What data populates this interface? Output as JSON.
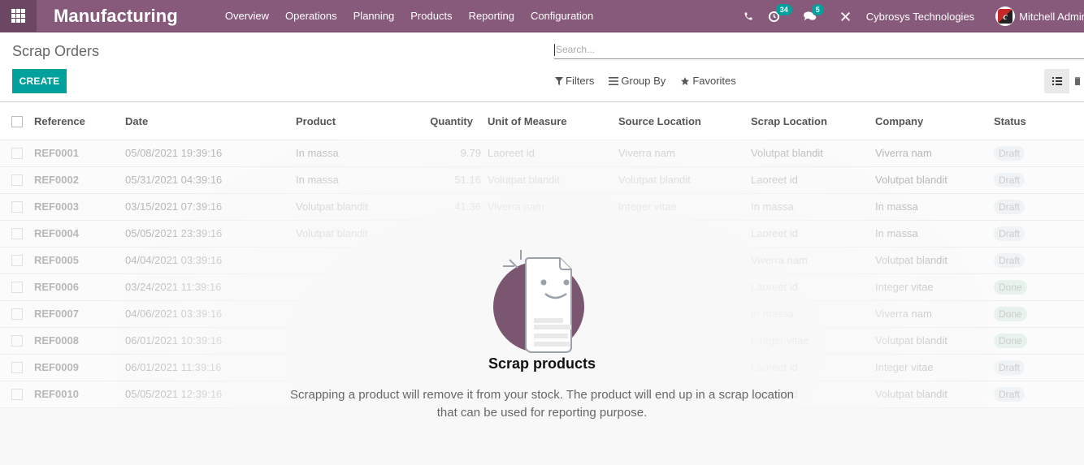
{
  "navbar": {
    "apps_icon": "grid-icon",
    "brand": "Manufacturing",
    "menu": [
      "Overview",
      "Operations",
      "Planning",
      "Products",
      "Reporting",
      "Configuration"
    ],
    "systray": {
      "phone_icon": "phone-icon",
      "activity_icon": "clock-icon",
      "activity_count": "34",
      "messages_icon": "chat-icon",
      "messages_count": "5",
      "debug_icon": "tools-icon",
      "company": "Cybrosys Technologies",
      "user": "Mitchell Admin"
    }
  },
  "control_panel": {
    "title": "Scrap Orders",
    "create_label": "CREATE",
    "search_placeholder": "Search...",
    "search_value": "",
    "filters_label": "Filters",
    "groupby_label": "Group By",
    "favorites_label": "Favorites",
    "views": [
      {
        "name": "list",
        "icon": "list-view-icon",
        "active": true
      },
      {
        "name": "kanban",
        "icon": "kanban-view-icon",
        "active": false
      }
    ]
  },
  "table": {
    "columns": [
      "Reference",
      "Date",
      "Product",
      "Quantity",
      "Unit of Measure",
      "Source Location",
      "Scrap Location",
      "Company",
      "Status"
    ],
    "rows": [
      {
        "ref": "REF0001",
        "date": "05/08/2021 19:39:16",
        "product": "In massa",
        "qty": "9.79",
        "uom": "Laoreet id",
        "source": "Viverra nam",
        "scrap": "Volutpat blandit",
        "company": "Viverra nam",
        "status": "Draft"
      },
      {
        "ref": "REF0002",
        "date": "05/31/2021 04:39:16",
        "product": "In massa",
        "qty": "51.16",
        "uom": "Volutpat blandit",
        "source": "Volutpat blandit",
        "scrap": "Laoreet id",
        "company": "Volutpat blandit",
        "status": "Draft"
      },
      {
        "ref": "REF0003",
        "date": "03/15/2021 07:39:16",
        "product": "Volutpat blandit",
        "qty": "41.36",
        "uom": "Viverra nam",
        "source": "Integer vitae",
        "scrap": "In massa",
        "company": "In massa",
        "status": "Draft"
      },
      {
        "ref": "REF0004",
        "date": "05/05/2021 23:39:16",
        "product": "Volutpat blandit",
        "qty": "",
        "uom": "",
        "source": "",
        "scrap": "Laoreet id",
        "company": "In massa",
        "status": "Draft"
      },
      {
        "ref": "REF0005",
        "date": "04/04/2021 03:39:16",
        "product": "",
        "qty": "",
        "uom": "",
        "source": "",
        "scrap": "Viverra nam",
        "company": "Volutpat blandit",
        "status": "Draft"
      },
      {
        "ref": "REF0006",
        "date": "03/24/2021 11:39:16",
        "product": "",
        "qty": "",
        "uom": "",
        "source": "",
        "scrap": "Laoreet id",
        "company": "Integer vitae",
        "status": "Done"
      },
      {
        "ref": "REF0007",
        "date": "04/06/2021 03:39:16",
        "product": "",
        "qty": "",
        "uom": "",
        "source": "",
        "scrap": "In massa",
        "company": "Viverra nam",
        "status": "Done"
      },
      {
        "ref": "REF0008",
        "date": "06/01/2021 10:39:16",
        "product": "",
        "qty": "",
        "uom": "",
        "source": "",
        "scrap": "Integer vitae",
        "company": "Volutpat blandit",
        "status": "Done"
      },
      {
        "ref": "REF0009",
        "date": "06/01/2021 11:39:16",
        "product": "",
        "qty": "",
        "uom": "",
        "source": "",
        "scrap": "Laoreet id",
        "company": "Integer vitae",
        "status": "Draft"
      },
      {
        "ref": "REF0010",
        "date": "05/05/2021 12:39:16",
        "product": "",
        "qty": "",
        "uom": "",
        "source": "",
        "scrap": "Laoreet id",
        "company": "Volutpat blandit",
        "status": "Draft"
      }
    ]
  },
  "help": {
    "icon": "smiling-document-icon",
    "title": "Scrap products",
    "text_line1": "Scrapping a product will remove it from your stock. The product will end up in a scrap location",
    "text_line2": "that can be used for reporting purpose."
  },
  "colors": {
    "brand": "#875a7b",
    "primary": "#00a09d",
    "draft_badge": "#e2ecf0",
    "done_badge": "#cfeadb"
  }
}
